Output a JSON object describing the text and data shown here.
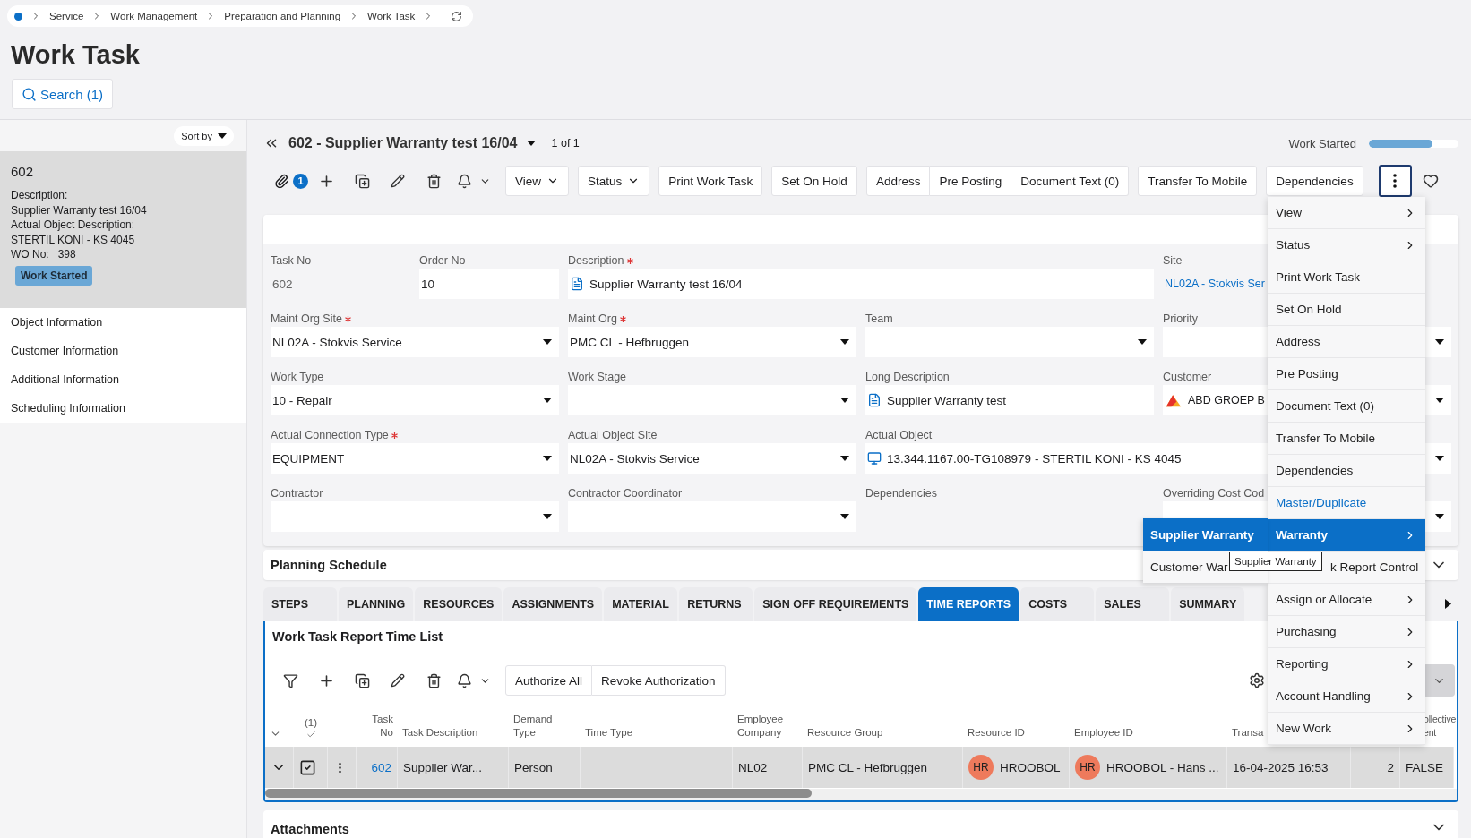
{
  "breadcrumb": {
    "items": [
      "Service",
      "Work Management",
      "Preparation and Planning",
      "Work Task"
    ]
  },
  "page_title": "Work Task",
  "search_button": "Search (1)",
  "sidebar": {
    "sort_label": "Sort by",
    "card": {
      "title": "602",
      "lines": [
        "Description:",
        "Supplier Warranty test 16/04",
        "Actual Object Description:",
        "STERTIL KONI - KS 4045",
        "WO No:   398"
      ],
      "badge": "Work Started",
      "selected": true
    },
    "sections": [
      "Object Information",
      "Customer Information",
      "Additional Information",
      "Scheduling Information"
    ]
  },
  "record": {
    "title": "602 - Supplier Warranty test 16/04",
    "counter": "1 of 1",
    "status": "Work Started",
    "level": 0.71
  },
  "toolbar": {
    "attachment_count": "1",
    "more_open": true,
    "button_groups": [
      [
        {
          "label": "View",
          "dropdown": true
        }
      ],
      [
        {
          "label": "Status",
          "dropdown": true
        }
      ],
      [
        {
          "label": "Print Work Task",
          "dropdown": false
        }
      ],
      [
        {
          "label": "Set On Hold",
          "dropdown": false
        }
      ],
      [
        {
          "label": "Address",
          "dropdown": false
        },
        {
          "label": "Pre Posting",
          "dropdown": false
        },
        {
          "label": "Document Text (0)",
          "dropdown": false
        }
      ],
      [
        {
          "label": "Transfer To Mobile",
          "dropdown": false
        }
      ],
      [
        {
          "label": "Dependencies",
          "dropdown": false
        }
      ]
    ]
  },
  "form": {
    "fields": [
      {
        "label": "Task No",
        "required": false,
        "kind": "readonly",
        "value": "602"
      },
      {
        "label": "Order No",
        "required": false,
        "kind": "input",
        "value": "10"
      },
      {
        "label": "Description",
        "required": true,
        "kind": "doc",
        "value": "Supplier Warranty test 16/04"
      },
      {
        "label": "Site",
        "required": false,
        "kind": "link",
        "value": "NL02A - Stokvis Ser"
      },
      {
        "label": "Maint Org Site",
        "required": true,
        "kind": "select",
        "value": "NL02A - Stokvis Service"
      },
      {
        "label": "Maint Org",
        "required": true,
        "kind": "select",
        "value": "PMC CL - Hefbruggen"
      },
      {
        "label": "Team",
        "required": false,
        "kind": "select"
      },
      {
        "label": "Priority",
        "required": false,
        "kind": "select"
      },
      {
        "label": "Work Type",
        "required": false,
        "kind": "select",
        "value": "10 - Repair"
      },
      {
        "label": "Work Stage",
        "required": false,
        "kind": "select"
      },
      {
        "label": "Long Description",
        "required": false,
        "kind": "doc",
        "value": "Supplier Warranty test"
      },
      {
        "label": "Customer",
        "required": false,
        "kind": "customer",
        "value": "ABD GROEP B"
      },
      {
        "label": "Actual Connection Type",
        "required": true,
        "kind": "select",
        "value": "EQUIPMENT"
      },
      {
        "label": "Actual Object Site",
        "required": false,
        "kind": "select",
        "value": "NL02A - Stokvis Service"
      },
      {
        "label": "Actual Object",
        "required": false,
        "kind": "object",
        "value": "13.344.1167.00-TG108979 - STERTIL KONI - KS 4045"
      },
      {
        "label": "Contractor",
        "required": false,
        "kind": "select"
      },
      {
        "label": "Contractor Coordinator",
        "required": false,
        "kind": "select"
      },
      {
        "label": "Dependencies",
        "required": false,
        "kind": "none"
      },
      {
        "label": "Overriding Cost Cod",
        "required": false,
        "kind": "select"
      }
    ]
  },
  "planning_schedule": {
    "title": "Planning Schedule"
  },
  "tabs": [
    {
      "label": "STEPS",
      "selected": false
    },
    {
      "label": "PLANNING",
      "selected": false
    },
    {
      "label": "RESOURCES",
      "selected": false
    },
    {
      "label": "ASSIGNMENTS",
      "selected": false
    },
    {
      "label": "MATERIAL",
      "selected": false
    },
    {
      "label": "RETURNS",
      "selected": false
    },
    {
      "label": "SIGN OFF REQUIREMENTS",
      "selected": false
    },
    {
      "label": "TIME REPORTS",
      "selected": true
    },
    {
      "label": "COSTS",
      "selected": false
    },
    {
      "label": "SALES",
      "selected": false
    },
    {
      "label": "SUMMARY",
      "selected": false
    }
  ],
  "time_list": {
    "title": "Work Task Report Time List",
    "actions": [
      "Authorize All",
      "Revoke Authorization"
    ],
    "selection_header": "(1)",
    "columns": [
      "Task\nNo",
      "Task Description",
      "Demand\nType",
      "Time Type",
      "Employee\nCompany",
      "Resource Group",
      "Resource ID",
      "Employee ID",
      "Transa",
      null,
      "ollective\nent"
    ],
    "rows": [
      {
        "selected": true,
        "checked": true,
        "cells": [
          {
            "kind": "link",
            "text": "602"
          },
          {
            "kind": "text",
            "text": "Supplier War..."
          },
          {
            "kind": "text",
            "text": "Person"
          },
          null,
          {
            "kind": "text",
            "text": "NL02"
          },
          {
            "kind": "text",
            "text": "PMC CL - Hefbruggen"
          },
          {
            "kind": "person",
            "initials": "HR",
            "text": "HROOBOL"
          },
          {
            "kind": "person",
            "initials": "HR",
            "text": "HROOBOL - Hans ..."
          },
          {
            "kind": "text",
            "text": "16-04-2025 16:53"
          },
          {
            "kind": "number",
            "text": "2"
          },
          {
            "kind": "text",
            "text": "FALSE"
          }
        ]
      }
    ]
  },
  "attachments": {
    "title": "Attachments"
  },
  "menu": {
    "items": [
      {
        "label": "View",
        "kind": "submenu",
        "selected": false
      },
      {
        "label": "Status",
        "kind": "submenu",
        "selected": false
      },
      {
        "label": "Print Work Task",
        "kind": "command",
        "selected": false
      },
      {
        "label": "Set On Hold",
        "kind": "command",
        "selected": false
      },
      {
        "label": "Address",
        "kind": "command",
        "selected": false
      },
      {
        "label": "Pre Posting",
        "kind": "command",
        "selected": false
      },
      {
        "label": "Document Text (0)",
        "kind": "command",
        "selected": false
      },
      {
        "label": "Transfer To Mobile",
        "kind": "command",
        "selected": false
      },
      {
        "label": "Dependencies",
        "kind": "command",
        "selected": false
      },
      {
        "label": "Master/Duplicate",
        "kind": "link",
        "selected": false
      },
      {
        "label": "Warranty",
        "kind": "submenu",
        "selected": true
      },
      {
        "label": "k Report Control",
        "kind": "partial",
        "selected": false
      },
      {
        "label": "Assign or Allocate",
        "kind": "submenu",
        "selected": false
      },
      {
        "label": "Purchasing",
        "kind": "submenu",
        "selected": false
      },
      {
        "label": "Reporting",
        "kind": "submenu",
        "selected": false
      },
      {
        "label": "Account Handling",
        "kind": "submenu",
        "selected": false
      },
      {
        "label": "New Work",
        "kind": "submenu",
        "selected": false
      }
    ]
  },
  "submenu": {
    "items": [
      {
        "label": "Supplier Warranty",
        "selected": true
      },
      {
        "label": "Customer War",
        "selected": false
      }
    ]
  },
  "tooltip": "Supplier Warranty"
}
